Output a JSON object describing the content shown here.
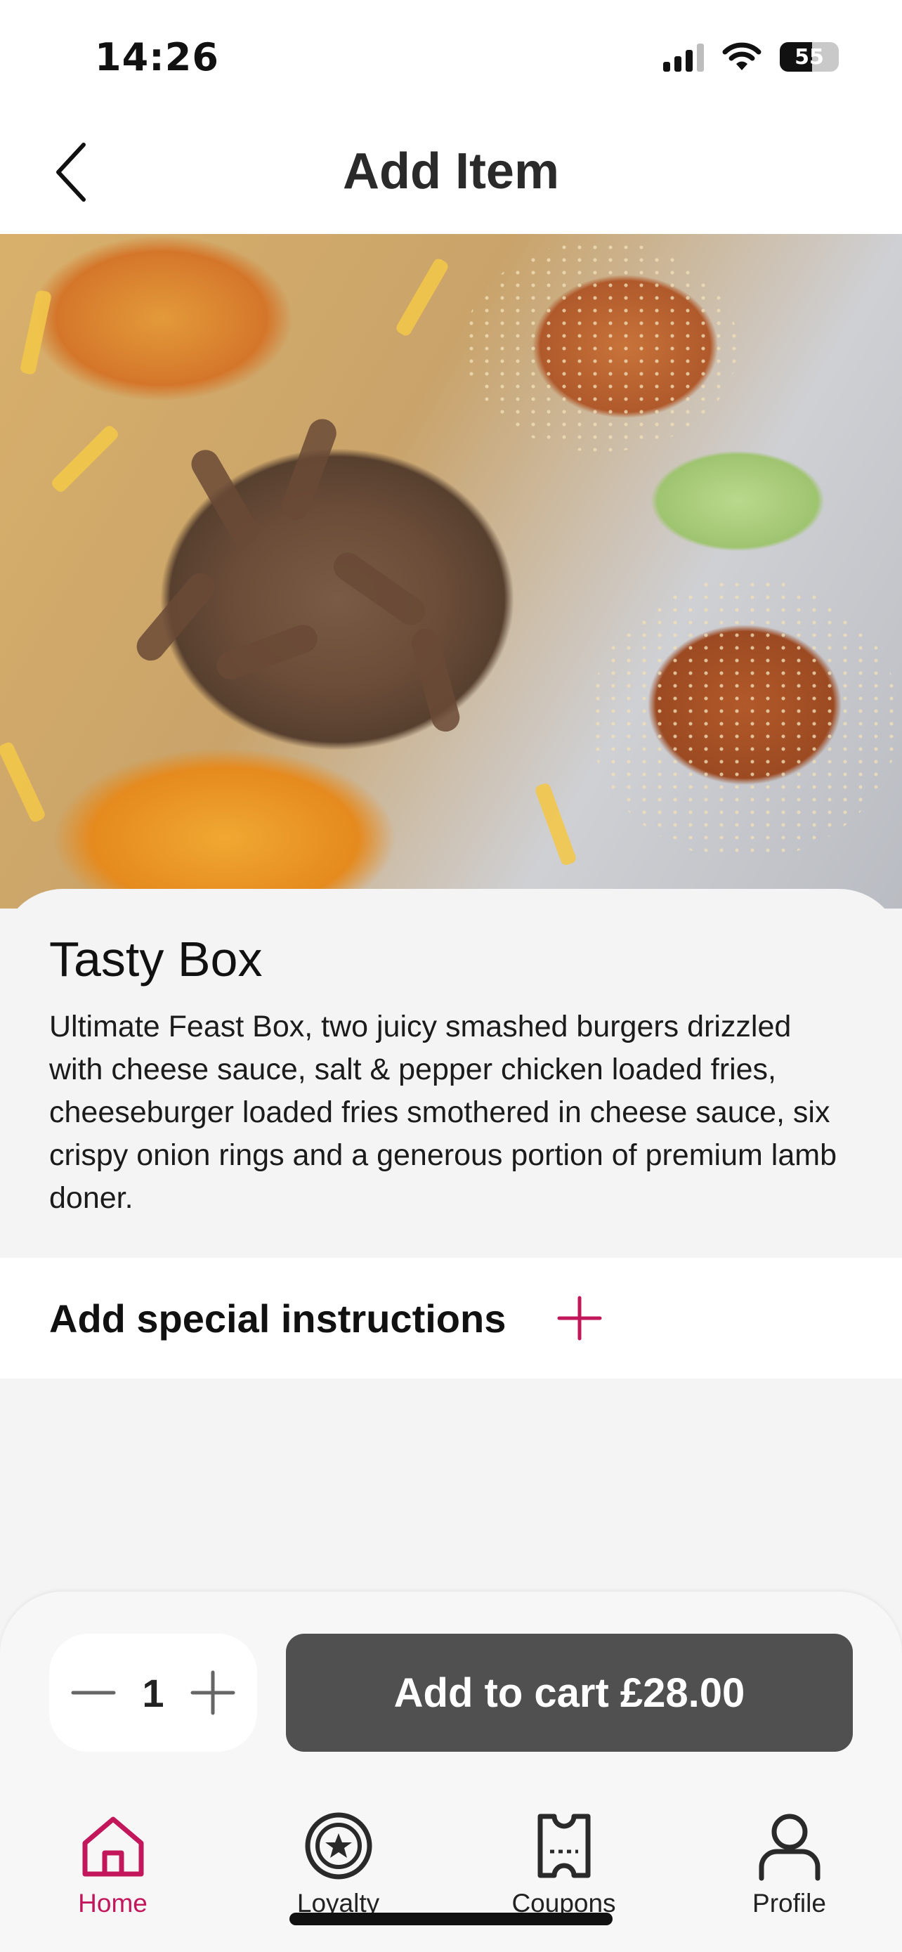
{
  "status_bar": {
    "time": "14:26",
    "battery": "55",
    "battery_level": 0.55
  },
  "header": {
    "title": "Add Item",
    "back_icon": "chevron-left-icon"
  },
  "item": {
    "name": "Tasty Box",
    "description": "Ultimate Feast Box, two juicy smashed burgers drizzled with cheese sauce, salt & pepper chicken loaded fries, cheeseburger loaded fries smothered in cheese sauce, six crispy onion rings and a generous portion of premium lamb doner."
  },
  "instructions": {
    "label": "Add special instructions",
    "icon": "plus-icon"
  },
  "cart": {
    "quantity": "1",
    "button_label": "Add to cart £28.00"
  },
  "tabs": [
    {
      "label": "Home",
      "icon": "home-icon",
      "active": true
    },
    {
      "label": "Loyalty",
      "icon": "star-badge-icon",
      "active": false
    },
    {
      "label": "Coupons",
      "icon": "coupon-icon",
      "active": false
    },
    {
      "label": "Profile",
      "icon": "user-icon",
      "active": false
    }
  ],
  "colors": {
    "accent": "#c2185b",
    "cart_button": "#505050"
  }
}
